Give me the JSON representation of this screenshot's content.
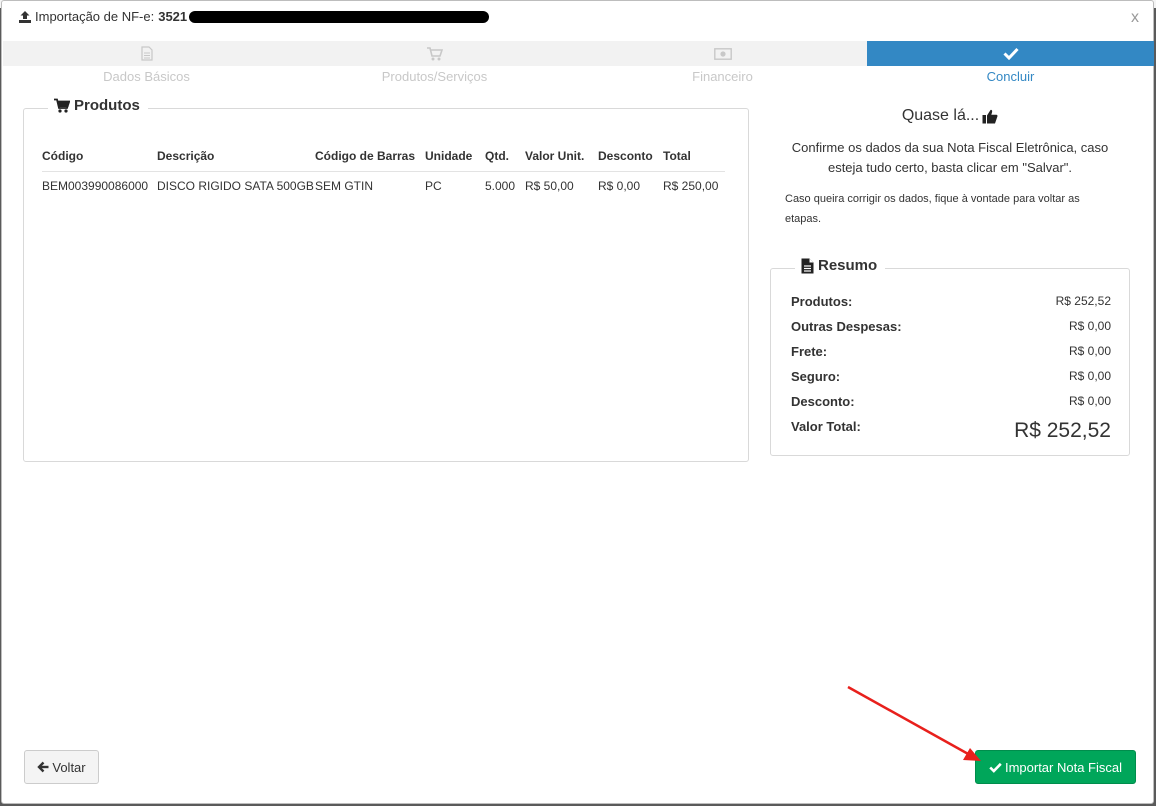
{
  "modal": {
    "title_prefix": "Importação de NF-e:",
    "nf_number_visible": "3521",
    "close_label": "x"
  },
  "wizard": {
    "steps": [
      {
        "label": "Dados Básicos",
        "icon": "file-icon",
        "state": "done"
      },
      {
        "label": "Produtos/Serviços",
        "icon": "cart-icon",
        "state": "done"
      },
      {
        "label": "Financeiro",
        "icon": "money-icon",
        "state": "done"
      },
      {
        "label": "Concluir",
        "icon": "check-icon",
        "state": "active"
      }
    ]
  },
  "produtos": {
    "title": "Produtos",
    "columns": [
      "Código",
      "Descrição",
      "Código de Barras",
      "Unidade",
      "Qtd.",
      "Valor Unit.",
      "Desconto",
      "Total"
    ],
    "rows": [
      [
        "BEM003990086000",
        "DISCO RIGIDO SATA 500GB",
        "SEM GTIN",
        "PC",
        "5.000",
        "R$ 50,00",
        "R$ 0,00",
        "R$ 250,00"
      ]
    ]
  },
  "conclusao": {
    "heading": "Quase lá...",
    "confirm_text": "Confirme os dados da sua Nota Fiscal Eletrônica, caso esteja tudo certo, basta clicar em \"Salvar\".",
    "note": "Caso queira corrigir os dados, fique à vontade para voltar as etapas."
  },
  "resumo": {
    "title": "Resumo",
    "items": [
      {
        "label": "Produtos:",
        "value": "R$ 252,52"
      },
      {
        "label": "Outras Despesas:",
        "value": "R$ 0,00"
      },
      {
        "label": "Frete:",
        "value": "R$ 0,00"
      },
      {
        "label": "Seguro:",
        "value": "R$ 0,00"
      },
      {
        "label": "Desconto:",
        "value": "R$ 0,00"
      }
    ],
    "total_label": "Valor Total:",
    "total_value": "R$ 252,52"
  },
  "buttons": {
    "voltar": "Voltar",
    "importar": "Importar Nota Fiscal"
  },
  "colors": {
    "active_step": "#3388c4",
    "success": "#00a65a",
    "annotation_arrow": "#e8201c"
  }
}
